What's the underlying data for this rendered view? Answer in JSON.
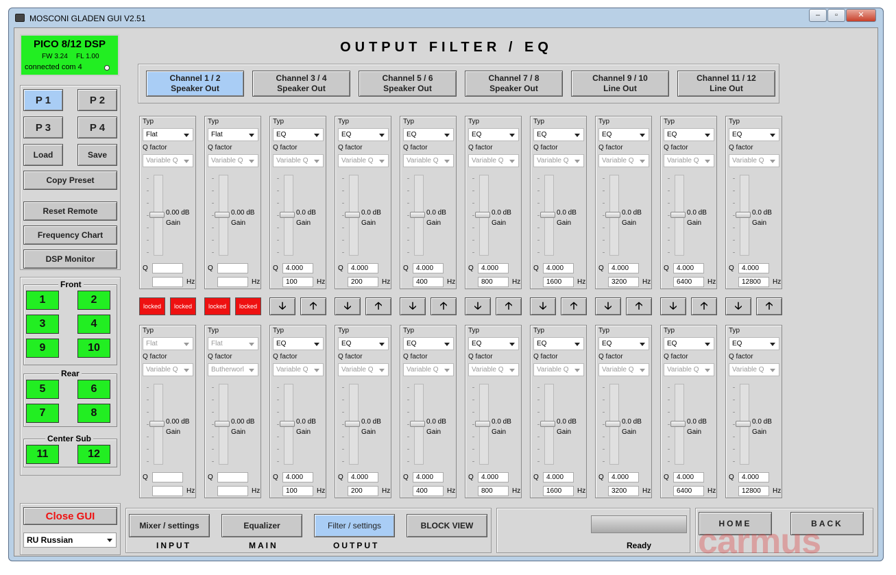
{
  "window": {
    "title": "MOSCONI GLADEN GUI V2.51",
    "controls": [
      "–",
      "▫",
      "✕"
    ]
  },
  "device": {
    "name": "PICO 8/12 DSP",
    "fw": "FW 3.24",
    "fl": "FL 1.00",
    "status": "connected com 4"
  },
  "presets": [
    "P 1",
    "P 2",
    "P 3",
    "P 4"
  ],
  "actions": {
    "load": "Load",
    "save": "Save",
    "copy": "Copy Preset",
    "reset": "Reset Remote",
    "freq": "Frequency Chart",
    "monitor": "DSP Monitor"
  },
  "groups": {
    "front": "Front",
    "rear": "Rear",
    "center_sub": "Center Sub"
  },
  "channels": {
    "front": [
      "1",
      "2",
      "3",
      "4",
      "9",
      "10"
    ],
    "rear": [
      "5",
      "6",
      "7",
      "8"
    ],
    "center_sub": [
      "11",
      "12"
    ]
  },
  "close_label": "Close GUI",
  "language": "RU Russian",
  "page_title": "OUTPUT FILTER / EQ",
  "tabs": [
    {
      "l1": "Channel 1 / 2",
      "l2": "Speaker Out"
    },
    {
      "l1": "Channel 3 / 4",
      "l2": "Speaker Out"
    },
    {
      "l1": "Channel 5 / 6",
      "l2": "Speaker Out"
    },
    {
      "l1": "Channel 7 / 8",
      "l2": "Speaker Out"
    },
    {
      "l1": "Channel 9 / 10",
      "l2": "Line Out"
    },
    {
      "l1": "Channel 11 / 12",
      "l2": "Line Out"
    }
  ],
  "labels": {
    "typ": "Typ",
    "qfactor": "Q factor",
    "gain": "Gain",
    "q": "Q",
    "hz": "Hz",
    "locked": "locked"
  },
  "top_strips": [
    {
      "typ": "Flat",
      "qf": "Variable Q",
      "db": "0.00 dB",
      "q": "",
      "hz": ""
    },
    {
      "typ": "Flat",
      "qf": "Variable Q",
      "db": "0.00 dB",
      "q": "",
      "hz": ""
    },
    {
      "typ": "EQ",
      "qf": "Variable Q",
      "db": "0.0 dB",
      "q": "4.000",
      "hz": "100"
    },
    {
      "typ": "EQ",
      "qf": "Variable Q",
      "db": "0.0 dB",
      "q": "4.000",
      "hz": "200"
    },
    {
      "typ": "EQ",
      "qf": "Variable Q",
      "db": "0.0 dB",
      "q": "4.000",
      "hz": "400"
    },
    {
      "typ": "EQ",
      "qf": "Variable Q",
      "db": "0.0 dB",
      "q": "4.000",
      "hz": "800"
    },
    {
      "typ": "EQ",
      "qf": "Variable Q",
      "db": "0.0 dB",
      "q": "4.000",
      "hz": "1600"
    },
    {
      "typ": "EQ",
      "qf": "Variable Q",
      "db": "0.0 dB",
      "q": "4.000",
      "hz": "3200"
    },
    {
      "typ": "EQ",
      "qf": "Variable Q",
      "db": "0.0 dB",
      "q": "4.000",
      "hz": "6400"
    },
    {
      "typ": "EQ",
      "qf": "Variable Q",
      "db": "0.0 dB",
      "q": "4.000",
      "hz": "12800"
    }
  ],
  "bottom_strips": [
    {
      "typ": "Flat",
      "qf": "Variable Q",
      "db": "0.00 dB",
      "q": "",
      "hz": ""
    },
    {
      "typ": "Flat",
      "qf": "Butherworl",
      "db": "0.00 dB",
      "q": "",
      "hz": ""
    },
    {
      "typ": "EQ",
      "qf": "Variable Q",
      "db": "0.0 dB",
      "q": "4.000",
      "hz": "100"
    },
    {
      "typ": "EQ",
      "qf": "Variable Q",
      "db": "0.0 dB",
      "q": "4.000",
      "hz": "200"
    },
    {
      "typ": "EQ",
      "qf": "Variable Q",
      "db": "0.0 dB",
      "q": "4.000",
      "hz": "400"
    },
    {
      "typ": "EQ",
      "qf": "Variable Q",
      "db": "0.0 dB",
      "q": "4.000",
      "hz": "800"
    },
    {
      "typ": "EQ",
      "qf": "Variable Q",
      "db": "0.0 dB",
      "q": "4.000",
      "hz": "1600"
    },
    {
      "typ": "EQ",
      "qf": "Variable Q",
      "db": "0.0 dB",
      "q": "4.000",
      "hz": "3200"
    },
    {
      "typ": "EQ",
      "qf": "Variable Q",
      "db": "0.0 dB",
      "q": "4.000",
      "hz": "6400"
    },
    {
      "typ": "EQ",
      "qf": "Variable Q",
      "db": "0.0 dB",
      "q": "4.000",
      "hz": "12800"
    }
  ],
  "arrows": {
    "down": "🡣",
    "up": "🡡"
  },
  "nav": {
    "mixer": "Mixer / settings",
    "eq": "Equalizer",
    "filter": "Filter / settings",
    "block": "BLOCK VIEW",
    "input": "INPUT",
    "main": "MAIN",
    "output": "OUTPUT",
    "home": "HOME",
    "back": "BACK"
  },
  "status": "Ready",
  "watermark": "carmus",
  "colors": {
    "active_tab": "#a9cdf5",
    "green": "#22ee22",
    "red": "#ee1111",
    "panel": "#d7d7d7"
  }
}
